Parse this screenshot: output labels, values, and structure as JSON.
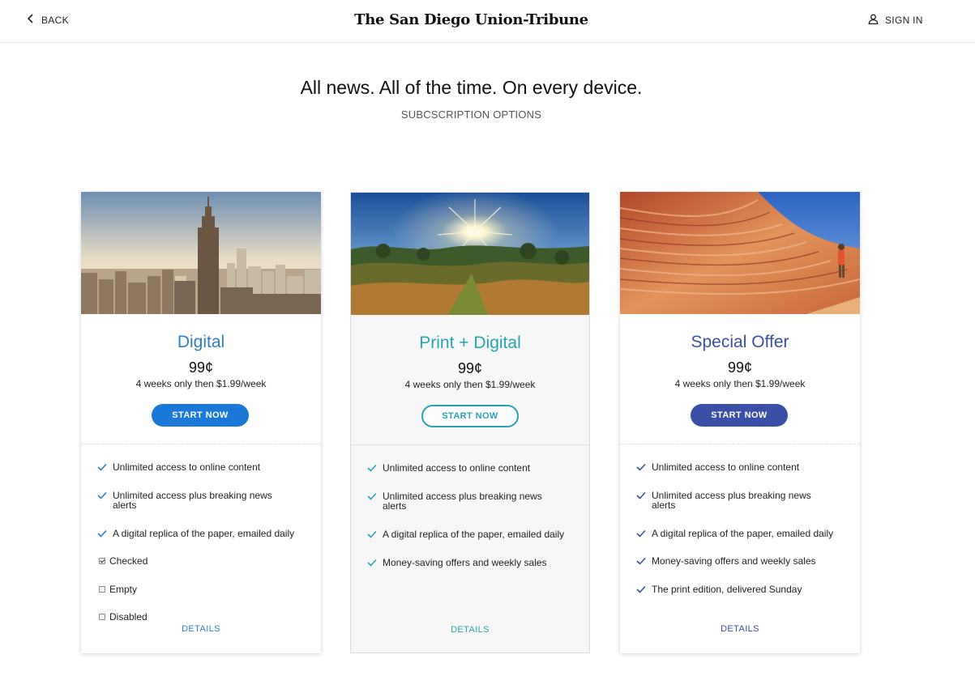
{
  "header": {
    "back_label": "BACK",
    "logo_text": "The San Diego Union-Tribune",
    "signin_label": "SIGN IN"
  },
  "hero": {
    "headline": "All news. All of the time. On every device.",
    "subheadline": "SUBCSCRIPTION OPTIONS"
  },
  "colors": {
    "digital": "#2f7fc1",
    "print_digital": "#27a3b3",
    "special": "#3a4fa6",
    "start_blue": "#1a78d8"
  },
  "plans": [
    {
      "title": "Digital",
      "price": "99¢",
      "terms": "4 weeks only then $1.99/week",
      "cta": "START NOW",
      "details": "DETAILS",
      "image": "city-skyline-photo",
      "features": [
        "Unlimited access to online content",
        "Unlimited access plus breaking news alerts",
        "A digital replica of the paper, emailed daily"
      ],
      "checkboxes": [
        {
          "label": "Checked",
          "checked": true
        },
        {
          "label": "Empty",
          "checked": false
        },
        {
          "label": "Disabled",
          "checked": false
        }
      ]
    },
    {
      "title": "Print + Digital",
      "price": "99¢",
      "terms": "4 weeks only then $1.99/week",
      "cta": "START NOW",
      "details": "DETAILS",
      "image": "sunrise-landscape-photo",
      "features": [
        "Unlimited access to online content",
        "Unlimited access plus breaking news alerts",
        "A digital replica of the paper, emailed daily",
        "Money-saving offers and weekly sales"
      ]
    },
    {
      "title": "Special Offer",
      "price": "99¢",
      "terms": "4 weeks only then $1.99/week",
      "cta": "START NOW",
      "details": "DETAILS",
      "image": "sandstone-canyon-photo",
      "features": [
        "Unlimited access to online content",
        "Unlimited access plus breaking news alerts",
        "A digital replica of the paper, emailed daily",
        "Money-saving offers and weekly sales",
        "The print edition, delivered Sunday"
      ]
    }
  ]
}
